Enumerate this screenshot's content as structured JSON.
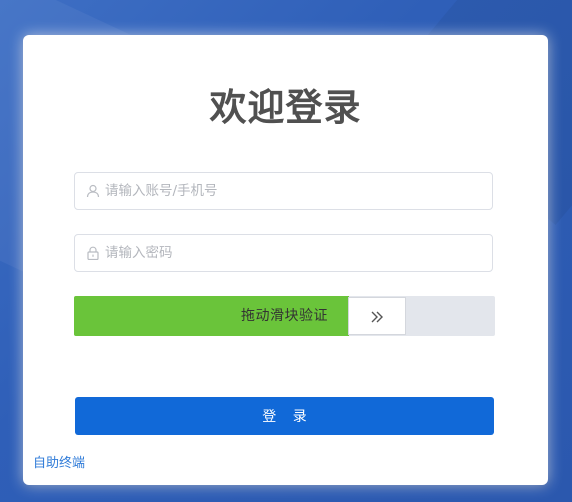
{
  "login": {
    "title": "欢迎登录",
    "username": {
      "icon": "user-icon",
      "placeholder": "请输入账号/手机号",
      "value": ""
    },
    "password": {
      "icon": "lock-icon",
      "placeholder": "请输入密码",
      "value": ""
    },
    "slider": {
      "label": "拖动滑块验证",
      "handle_icon": "double-chevron-right-icon",
      "progress": 0.65
    },
    "submit_label": "登 录",
    "self_service_link": "自助终端"
  },
  "colors": {
    "background": "#2f5fb8",
    "card": "#ffffff",
    "title": "#505050",
    "slider_fill": "#6ac43a",
    "slider_track": "#e3e6ec",
    "primary_button": "#1169d8",
    "link": "#2f7bd8"
  }
}
